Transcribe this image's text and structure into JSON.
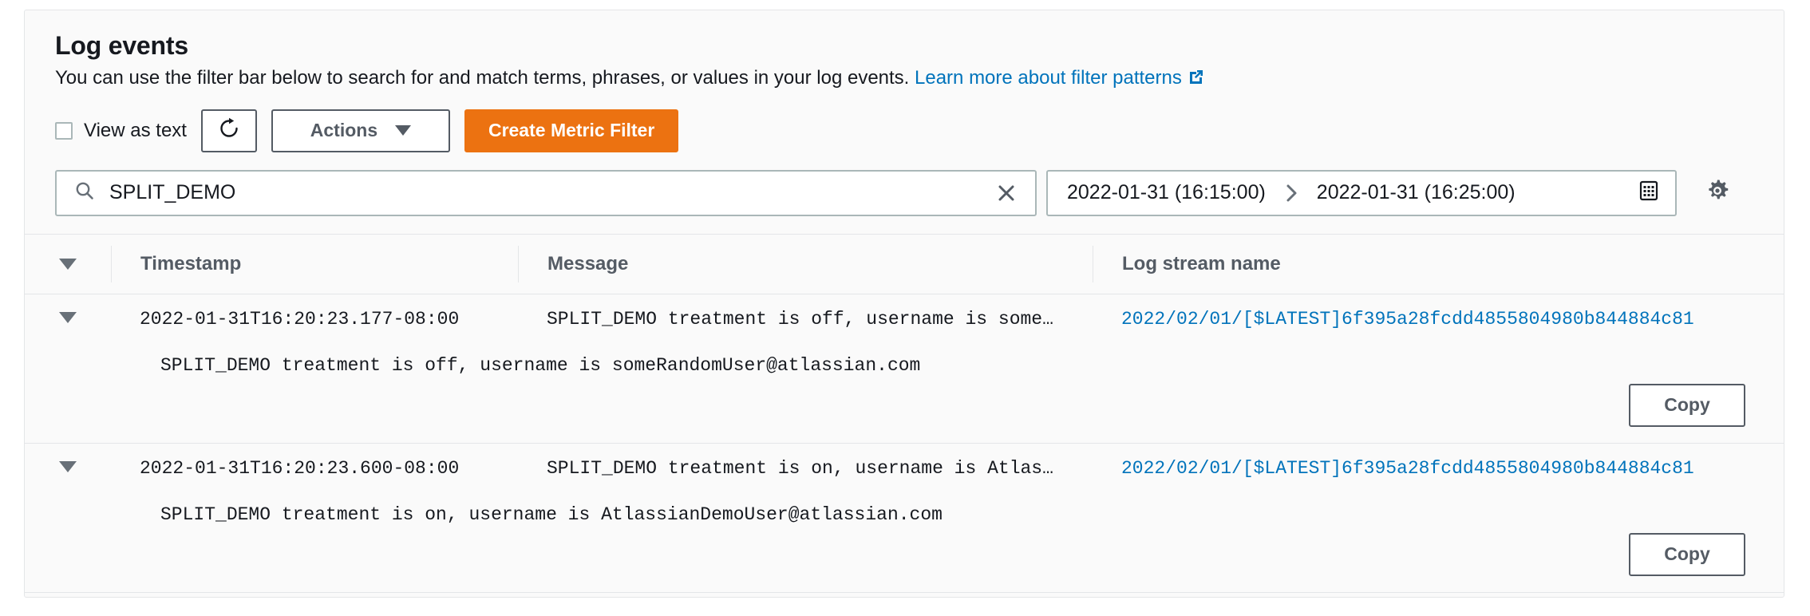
{
  "panel": {
    "title": "Log events",
    "description_before_link": "You can use the filter bar below to search for and match terms, phrases, or values in your log events. ",
    "link_text": "Learn more about filter patterns",
    "link_icon": "external-link-icon"
  },
  "toolbar": {
    "view_as_text_label": "View as text",
    "view_as_text_checked": false,
    "refresh_icon": "refresh-icon",
    "actions_label": "Actions",
    "actions_caret": "chevron-down-icon",
    "create_metric_filter_label": "Create Metric Filter",
    "primary_color": "#ec7211"
  },
  "filter": {
    "search_icon": "search-icon",
    "search_value": "SPLIT_DEMO",
    "search_placeholder": "Filter events",
    "clear_icon": "close-icon",
    "date_start": "2022-01-31 (16:15:00)",
    "date_separator_icon": "chevron-right-icon",
    "date_end": "2022-01-31 (16:25:00)",
    "calendar_icon": "calendar-icon",
    "settings_icon": "gear-icon"
  },
  "table": {
    "columns": {
      "toggle": "",
      "timestamp": "Timestamp",
      "message": "Message",
      "log_stream_name": "Log stream name"
    },
    "rows": [
      {
        "expanded": true,
        "timestamp": "2022-01-31T16:20:23.177-08:00",
        "message_truncated": "SPLIT_DEMO treatment is off, username is some…",
        "message_full": "SPLIT_DEMO treatment is off, username is someRandomUser@atlassian.com",
        "log_stream_name": "2022/02/01/[$LATEST]6f395a28fcdd4855804980b844884c81",
        "copy_label": "Copy"
      },
      {
        "expanded": true,
        "timestamp": "2022-01-31T16:20:23.600-08:00",
        "message_truncated": "SPLIT_DEMO treatment is on, username is Atlas…",
        "message_full": "SPLIT_DEMO treatment is on, username is AtlassianDemoUser@atlassian.com",
        "log_stream_name": "2022/02/01/[$LATEST]6f395a28fcdd4855804980b844884c81",
        "copy_label": "Copy"
      }
    ]
  }
}
